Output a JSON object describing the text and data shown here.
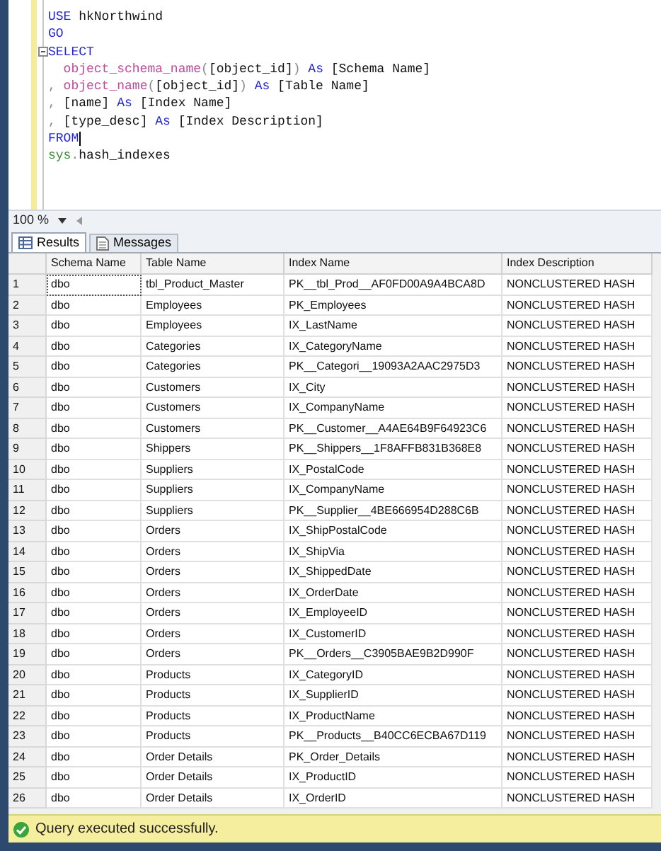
{
  "editor": {
    "lines": [
      {
        "collapsible": false,
        "tokens": [
          {
            "kind": "keyword",
            "text": "USE"
          },
          {
            "kind": "plain",
            "text": " hkNorthwind"
          }
        ]
      },
      {
        "collapsible": false,
        "tokens": [
          {
            "kind": "keyword",
            "text": "GO"
          }
        ]
      },
      {
        "collapsible": true,
        "tokens": [
          {
            "kind": "keyword",
            "text": "SELECT"
          }
        ]
      },
      {
        "collapsible": false,
        "tokens": [
          {
            "kind": "function",
            "text": "  object_schema_name"
          },
          {
            "kind": "punct",
            "text": "("
          },
          {
            "kind": "plain",
            "text": "[object_id]"
          },
          {
            "kind": "punct",
            "text": ")"
          },
          {
            "kind": "keyword",
            "text": " As"
          },
          {
            "kind": "plain",
            "text": " [Schema Name]"
          }
        ]
      },
      {
        "collapsible": false,
        "tokens": [
          {
            "kind": "punct",
            "text": ","
          },
          {
            "kind": "function",
            "text": " object_name"
          },
          {
            "kind": "punct",
            "text": "("
          },
          {
            "kind": "plain",
            "text": "[object_id]"
          },
          {
            "kind": "punct",
            "text": ")"
          },
          {
            "kind": "keyword",
            "text": " As"
          },
          {
            "kind": "plain",
            "text": " [Table Name]"
          }
        ]
      },
      {
        "collapsible": false,
        "tokens": [
          {
            "kind": "punct",
            "text": ","
          },
          {
            "kind": "plain",
            "text": " [name] "
          },
          {
            "kind": "keyword",
            "text": "As"
          },
          {
            "kind": "plain",
            "text": " [Index Name]"
          }
        ]
      },
      {
        "collapsible": false,
        "tokens": [
          {
            "kind": "punct",
            "text": ","
          },
          {
            "kind": "plain",
            "text": " [type_desc] "
          },
          {
            "kind": "keyword",
            "text": "As"
          },
          {
            "kind": "plain",
            "text": " [Index Description]"
          }
        ]
      },
      {
        "collapsible": false,
        "cursor": true,
        "tokens": [
          {
            "kind": "keyword",
            "text": "FROM"
          }
        ]
      },
      {
        "collapsible": false,
        "tokens": [
          {
            "kind": "system",
            "text": "sys"
          },
          {
            "kind": "punct",
            "text": "."
          },
          {
            "kind": "plain",
            "text": "hash_indexes"
          }
        ]
      }
    ]
  },
  "zoom": {
    "value": "100 %"
  },
  "tabs": [
    {
      "label": "Results",
      "selected": true
    },
    {
      "label": "Messages",
      "selected": false
    }
  ],
  "table": {
    "columns": [
      "Schema Name",
      "Table Name",
      "Index Name",
      "Index Description"
    ],
    "rows": [
      {
        "number": "1",
        "selected": true,
        "cells": [
          "dbo",
          "tbl_Product_Master",
          "PK__tbl_Prod__AF0FD00A9A4BCA8D",
          "NONCLUSTERED HASH"
        ]
      },
      {
        "number": "2",
        "selected": false,
        "cells": [
          "dbo",
          "Employees",
          "PK_Employees",
          "NONCLUSTERED HASH"
        ]
      },
      {
        "number": "3",
        "selected": false,
        "cells": [
          "dbo",
          "Employees",
          "IX_LastName",
          "NONCLUSTERED HASH"
        ]
      },
      {
        "number": "4",
        "selected": false,
        "cells": [
          "dbo",
          "Categories",
          "IX_CategoryName",
          "NONCLUSTERED HASH"
        ]
      },
      {
        "number": "5",
        "selected": false,
        "cells": [
          "dbo",
          "Categories",
          "PK__Categori__19093A2AAC2975D3",
          "NONCLUSTERED HASH"
        ]
      },
      {
        "number": "6",
        "selected": false,
        "cells": [
          "dbo",
          "Customers",
          "IX_City",
          "NONCLUSTERED HASH"
        ]
      },
      {
        "number": "7",
        "selected": false,
        "cells": [
          "dbo",
          "Customers",
          "IX_CompanyName",
          "NONCLUSTERED HASH"
        ]
      },
      {
        "number": "8",
        "selected": false,
        "cells": [
          "dbo",
          "Customers",
          "PK__Customer__A4AE64B9F64923C6",
          "NONCLUSTERED HASH"
        ]
      },
      {
        "number": "9",
        "selected": false,
        "cells": [
          "dbo",
          "Shippers",
          "PK__Shippers__1F8AFFB831B368E8",
          "NONCLUSTERED HASH"
        ]
      },
      {
        "number": "10",
        "selected": false,
        "cells": [
          "dbo",
          "Suppliers",
          "IX_PostalCode",
          "NONCLUSTERED HASH"
        ]
      },
      {
        "number": "11",
        "selected": false,
        "cells": [
          "dbo",
          "Suppliers",
          "IX_CompanyName",
          "NONCLUSTERED HASH"
        ]
      },
      {
        "number": "12",
        "selected": false,
        "cells": [
          "dbo",
          "Suppliers",
          "PK__Supplier__4BE666954D288C6B",
          "NONCLUSTERED HASH"
        ]
      },
      {
        "number": "13",
        "selected": false,
        "cells": [
          "dbo",
          "Orders",
          "IX_ShipPostalCode",
          "NONCLUSTERED HASH"
        ]
      },
      {
        "number": "14",
        "selected": false,
        "cells": [
          "dbo",
          "Orders",
          "IX_ShipVia",
          "NONCLUSTERED HASH"
        ]
      },
      {
        "number": "15",
        "selected": false,
        "cells": [
          "dbo",
          "Orders",
          "IX_ShippedDate",
          "NONCLUSTERED HASH"
        ]
      },
      {
        "number": "16",
        "selected": false,
        "cells": [
          "dbo",
          "Orders",
          "IX_OrderDate",
          "NONCLUSTERED HASH"
        ]
      },
      {
        "number": "17",
        "selected": false,
        "cells": [
          "dbo",
          "Orders",
          "IX_EmployeeID",
          "NONCLUSTERED HASH"
        ]
      },
      {
        "number": "18",
        "selected": false,
        "cells": [
          "dbo",
          "Orders",
          "IX_CustomerID",
          "NONCLUSTERED HASH"
        ]
      },
      {
        "number": "19",
        "selected": false,
        "cells": [
          "dbo",
          "Orders",
          "PK__Orders__C3905BAE9B2D990F",
          "NONCLUSTERED HASH"
        ]
      },
      {
        "number": "20",
        "selected": false,
        "cells": [
          "dbo",
          "Products",
          "IX_CategoryID",
          "NONCLUSTERED HASH"
        ]
      },
      {
        "number": "21",
        "selected": false,
        "cells": [
          "dbo",
          "Products",
          "IX_SupplierID",
          "NONCLUSTERED HASH"
        ]
      },
      {
        "number": "22",
        "selected": false,
        "cells": [
          "dbo",
          "Products",
          "IX_ProductName",
          "NONCLUSTERED HASH"
        ]
      },
      {
        "number": "23",
        "selected": false,
        "cells": [
          "dbo",
          "Products",
          "PK__Products__B40CC6ECBA67D119",
          "NONCLUSTERED HASH"
        ]
      },
      {
        "number": "24",
        "selected": false,
        "cells": [
          "dbo",
          "Order Details",
          "PK_Order_Details",
          "NONCLUSTERED HASH"
        ]
      },
      {
        "number": "25",
        "selected": false,
        "cells": [
          "dbo",
          "Order Details",
          "IX_ProductID",
          "NONCLUSTERED HASH"
        ]
      },
      {
        "number": "26",
        "selected": false,
        "cells": [
          "dbo",
          "Order Details",
          "IX_OrderID",
          "NONCLUSTERED HASH"
        ]
      }
    ]
  },
  "status_bar": {
    "text": "Query executed successfully."
  }
}
